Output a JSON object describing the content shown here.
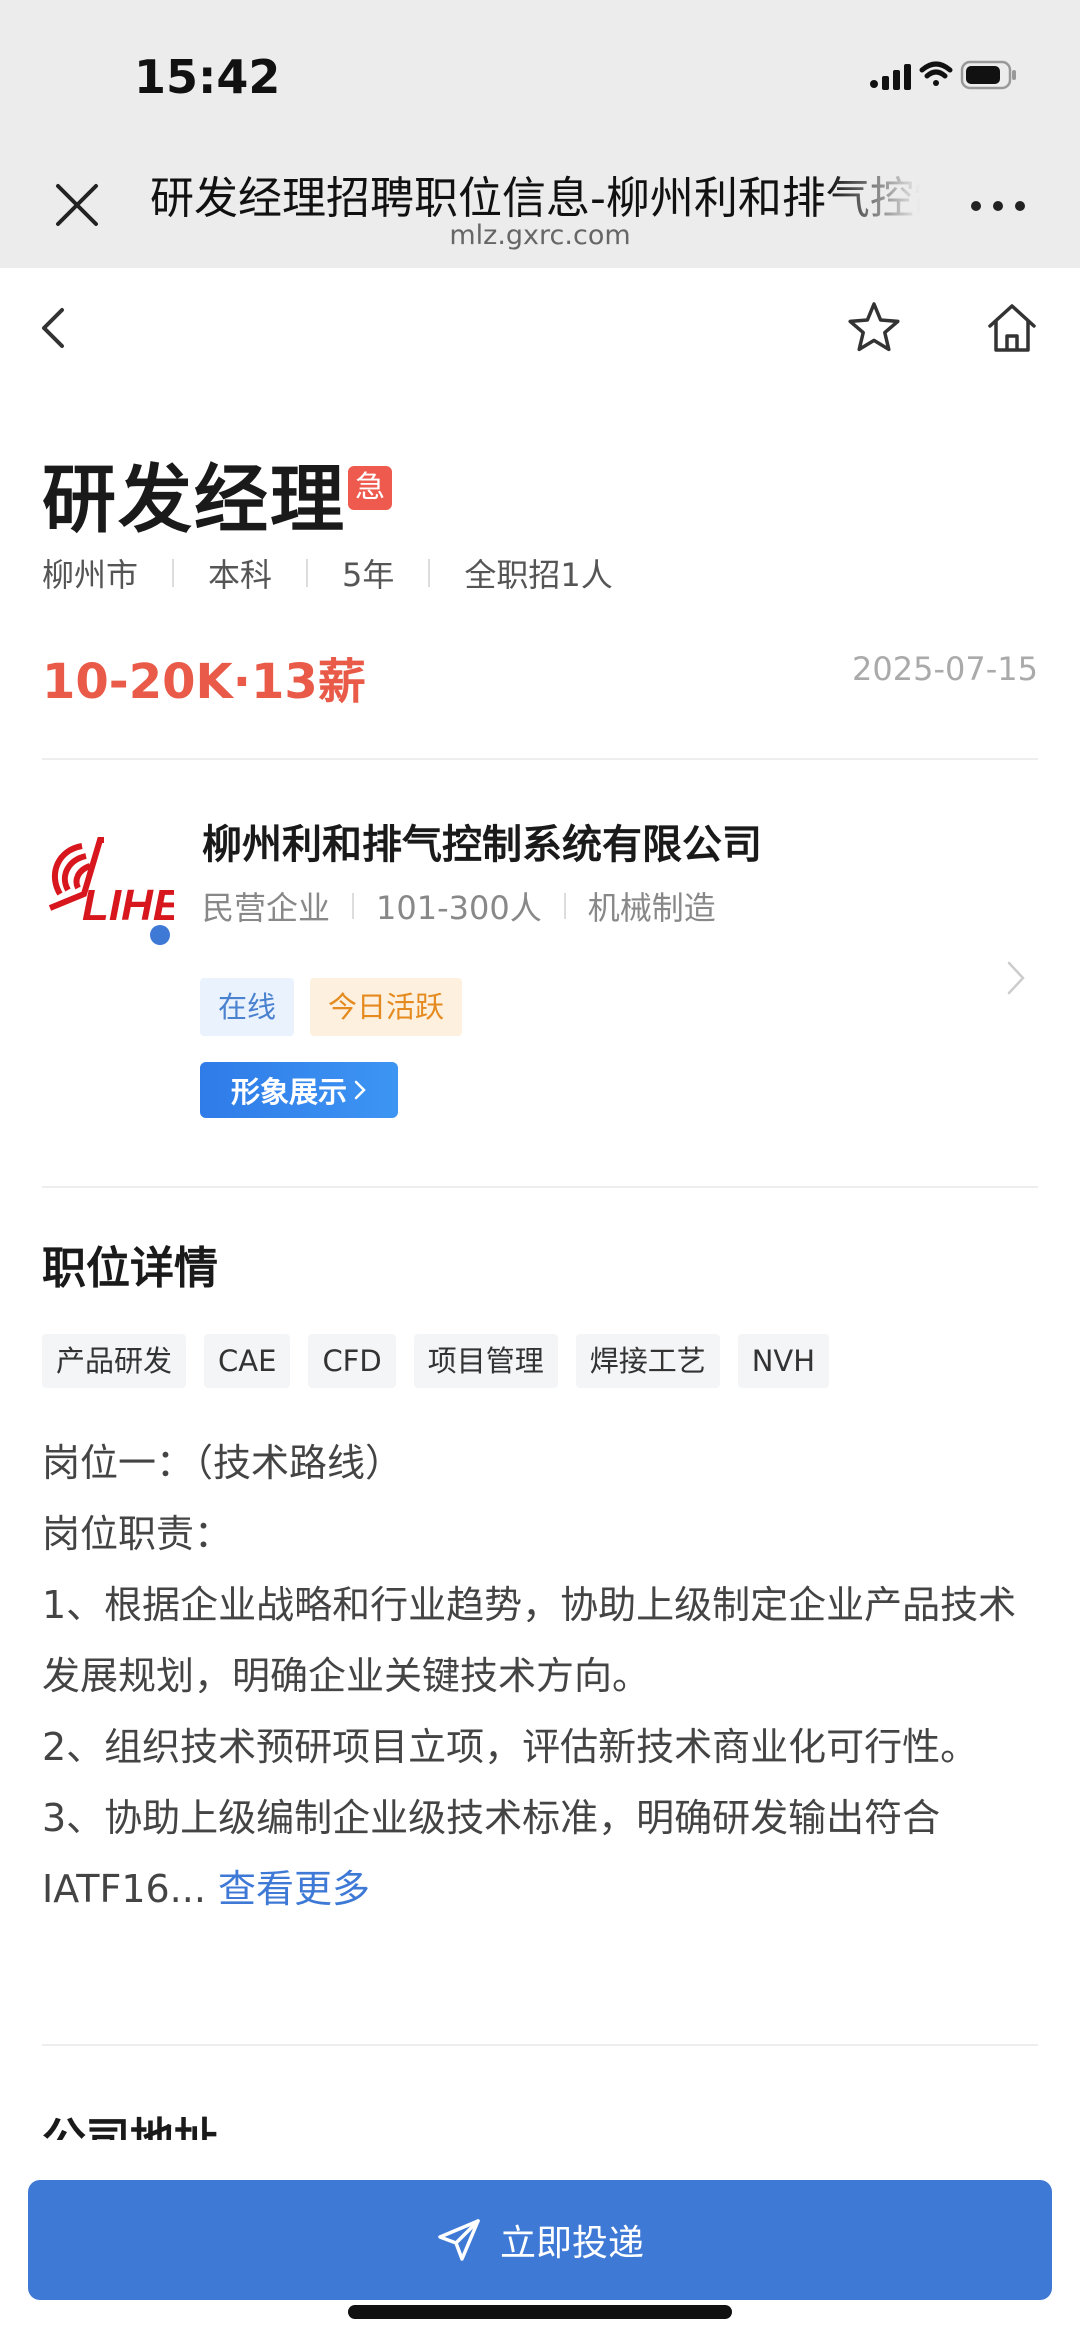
{
  "status_bar": {
    "time": "15:42"
  },
  "browser": {
    "title": "研发经理招聘职位信息-柳州利和排气控制系统有限公司",
    "url": "mlz.gxrc.com"
  },
  "job": {
    "title": "研发经理",
    "urgent_label": "急",
    "meta": [
      "柳州市",
      "本科",
      "5年",
      "全职招1人"
    ],
    "salary": "10-20K·13薪",
    "date": "2025-07-15"
  },
  "company": {
    "name": "柳州利和排气控制系统有限公司",
    "logo_text": "LIHE",
    "meta": [
      "民营企业",
      "101-300人",
      "机械制造"
    ],
    "tags": {
      "online": "在线",
      "active": "今日活跃"
    },
    "showcase_label": "形象展示"
  },
  "detail": {
    "title": "职位详情",
    "skills": [
      "产品研发",
      "CAE",
      "CFD",
      "项目管理",
      "焊接工艺",
      "NVH"
    ],
    "lines": [
      "岗位一：（技术路线）",
      "岗位职责：",
      "1、根据企业战略和行业趋势，协助上级制定企业产品技术发展规划，明确企业关键技术方向。",
      "2、组织技术预研项目立项，评估新技术商业化可行性。",
      "3、协助上级编制企业级技术标准，明确研发输出符合IATF16..."
    ],
    "see_more": "查看更多"
  },
  "next_section_title": "公司地址",
  "apply_button": "立即投递",
  "colors": {
    "accent": "#3f79d6",
    "salary": "#e95a48",
    "urgent": "#ee5a4d",
    "logo_red": "#d7161e"
  }
}
